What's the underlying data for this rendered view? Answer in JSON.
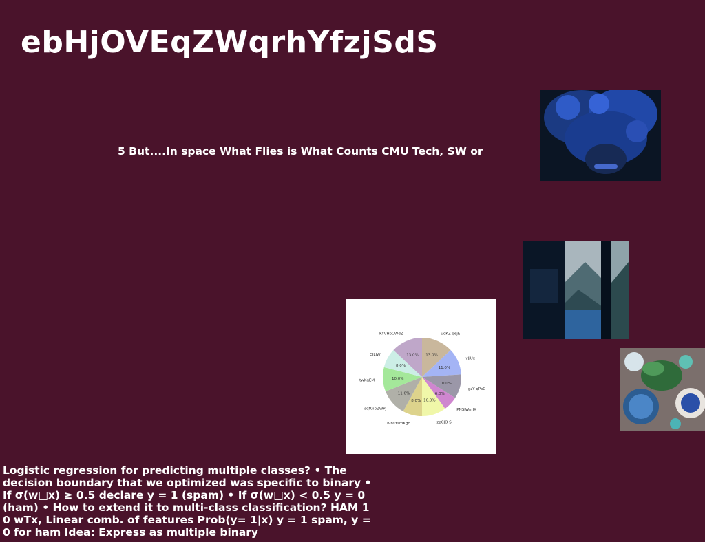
{
  "slide": {
    "title": "ebHjOVEqZWqrhYfzjSdS",
    "subtitle": "5 But....In space What Flies is What Counts CMU Tech, SW or",
    "body": "Logistic regression for predicting multiple classes? • The decision boundary that we optimized was specific to binary • If σ(w□x) ≥ 0.5 declare y = 1 (spam) • If σ(w□x) < 0.5 y = 0 (ham) • How to extend it to multi-class classification? HAM 1 0 wTx, Linear comb. of features Prob(y= 1|x) y = 1 spam, y = 0 for ham Idea: Express as multiple binary"
  },
  "chart_data": {
    "type": "pie",
    "slices": [
      {
        "label": "uoKZ qejE",
        "value": 13.0,
        "color": "#c9b79c"
      },
      {
        "label": "yJjUx",
        "value": 11.0,
        "color": "#a4b4f5"
      },
      {
        "label": "gzY qPoC",
        "value": 10.0,
        "color": "#9b97a8"
      },
      {
        "label": "PNSlWmJX",
        "value": 6.0,
        "color": "#cf86cf"
      },
      {
        "label": "zpCJO S",
        "value": 10.0,
        "color": "#f0f7a9"
      },
      {
        "label": "lVnsYsmKgo",
        "value": 8.0,
        "color": "#ddd38c"
      },
      {
        "label": "sqtGipZWPJ",
        "value": 11.0,
        "color": "#b0b0a8"
      },
      {
        "label": "twKqEM",
        "value": 10.0,
        "color": "#a4e89a"
      },
      {
        "label": "CJLIW",
        "value": 8.0,
        "color": "#cceee6"
      },
      {
        "label": "KYVHoCWdZ",
        "value": 13.0,
        "color": "#bfa7c9"
      }
    ],
    "pct_labels": [
      "13.0%",
      "11.0%",
      "10.0%",
      "6.0%",
      "10.0%",
      "8.0%",
      "11.0%",
      "10.0%",
      "8.0%",
      "13.0%"
    ]
  },
  "images": [
    {
      "name": "photo-blue-hair-portrait"
    },
    {
      "name": "photo-window-mountain-view"
    },
    {
      "name": "photo-herbs-and-bowls"
    }
  ]
}
